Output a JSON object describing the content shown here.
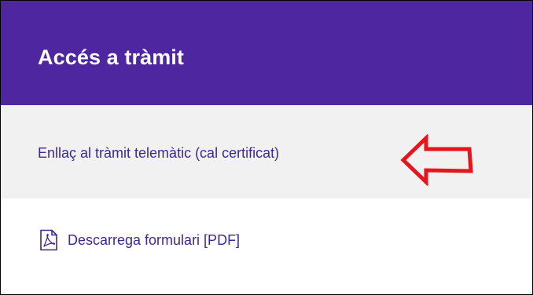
{
  "header": {
    "title": "Accés a tràmit"
  },
  "links": {
    "tramit_link_label": "Enllaç al tràmit telemàtic (cal certificat)",
    "pdf_link_label": "Descarrega formulari [PDF]"
  },
  "icons": {
    "pdf": "pdf-file-icon",
    "annotation": "left-arrow-annotation"
  },
  "colors": {
    "header_bg": "#4e27a0",
    "link_text": "#3f2890",
    "highlight_row_bg": "#f1f1f1",
    "annotation_red": "#e8141b"
  }
}
